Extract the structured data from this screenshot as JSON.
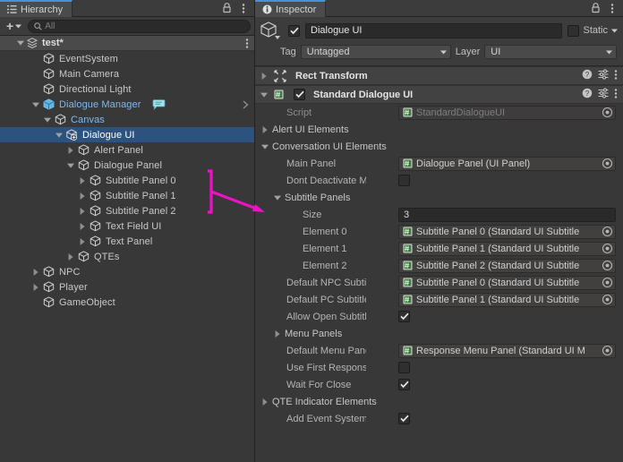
{
  "hierarchy": {
    "tab_label": "Hierarchy",
    "tab_icon": "hierarchy-icon",
    "lock_icon": "lock-icon",
    "menu_icon": "kebab-menu-icon",
    "toolbar": {
      "add_label": "+",
      "search_placeholder": "All",
      "search_value": "",
      "search_icon": "search-icon"
    },
    "scene": {
      "name": "test*",
      "icon": "scene-icon",
      "expanded": true
    },
    "items": [
      {
        "label": "EventSystem",
        "depth": 2,
        "arrow": "none",
        "icon": "cube-icon",
        "selected": false,
        "highlight": false
      },
      {
        "label": "Main Camera",
        "depth": 2,
        "arrow": "none",
        "icon": "cube-icon",
        "selected": false,
        "highlight": false
      },
      {
        "label": "Directional Light",
        "depth": 2,
        "arrow": "none",
        "icon": "cube-icon",
        "selected": false,
        "highlight": false
      },
      {
        "label": "Dialogue Manager",
        "depth": 2,
        "arrow": "expanded",
        "icon": "prefab-icon",
        "selected": false,
        "highlight": true,
        "badge": "dialogue-bubble-icon",
        "chevron": "chevron-right-icon"
      },
      {
        "label": "Canvas",
        "depth": 3,
        "arrow": "expanded",
        "icon": "cube-icon",
        "selected": false,
        "highlight": true
      },
      {
        "label": "Dialogue UI",
        "depth": 4,
        "arrow": "expanded",
        "icon": "prefab-add-icon",
        "selected": true,
        "highlight": false
      },
      {
        "label": "Alert Panel",
        "depth": 5,
        "arrow": "collapsed",
        "icon": "cube-icon",
        "selected": false,
        "highlight": false
      },
      {
        "label": "Dialogue Panel",
        "depth": 5,
        "arrow": "expanded",
        "icon": "cube-icon",
        "selected": false,
        "highlight": false
      },
      {
        "label": "Subtitle Panel 0",
        "depth": 6,
        "arrow": "collapsed",
        "icon": "cube-icon",
        "selected": false,
        "highlight": false
      },
      {
        "label": "Subtitle Panel 1",
        "depth": 6,
        "arrow": "collapsed",
        "icon": "cube-icon",
        "selected": false,
        "highlight": false
      },
      {
        "label": "Subtitle Panel 2",
        "depth": 6,
        "arrow": "collapsed",
        "icon": "cube-icon",
        "selected": false,
        "highlight": false
      },
      {
        "label": "Text Field UI",
        "depth": 6,
        "arrow": "collapsed",
        "icon": "cube-icon",
        "selected": false,
        "highlight": false
      },
      {
        "label": "Text Panel",
        "depth": 6,
        "arrow": "collapsed",
        "icon": "cube-icon",
        "selected": false,
        "highlight": false
      },
      {
        "label": "QTEs",
        "depth": 5,
        "arrow": "collapsed",
        "icon": "cube-icon",
        "selected": false,
        "highlight": false
      },
      {
        "label": "NPC",
        "depth": 2,
        "arrow": "collapsed",
        "icon": "cube-icon",
        "selected": false,
        "highlight": false
      },
      {
        "label": "Player",
        "depth": 2,
        "arrow": "collapsed",
        "icon": "cube-icon",
        "selected": false,
        "highlight": false
      },
      {
        "label": "GameObject",
        "depth": 2,
        "arrow": "none",
        "icon": "cube-icon",
        "selected": false,
        "highlight": false
      }
    ]
  },
  "inspector": {
    "tab_label": "Inspector",
    "tab_icon": "info-icon",
    "lock_icon": "lock-icon",
    "menu_icon": "kebab-menu-icon",
    "object": {
      "enabled": true,
      "name": "Dialogue UI",
      "static_label": "Static",
      "static_checked": false,
      "tag_label": "Tag",
      "tag_value": "Untagged",
      "layer_label": "Layer",
      "layer_value": "UI"
    },
    "components": [
      {
        "title": "Rect Transform",
        "icon": "rect-transform-icon",
        "expanded": false,
        "has_enable_toggle": false
      },
      {
        "title": "Standard Dialogue UI",
        "icon": "script-icon",
        "expanded": true,
        "has_enable_toggle": true,
        "enabled": true
      }
    ],
    "properties": [
      {
        "kind": "object",
        "label": "Script",
        "value": "StandardDialogueUI",
        "indent": 1,
        "disabled": true,
        "icon": "script-icon"
      },
      {
        "kind": "fold",
        "label": "Alert UI Elements",
        "expanded": false,
        "indent": 0
      },
      {
        "kind": "fold",
        "label": "Conversation UI Elements",
        "expanded": true,
        "indent": 0
      },
      {
        "kind": "object",
        "label": "Main Panel",
        "value": "Dialogue Panel (UI Panel)",
        "indent": 1,
        "disabled": false,
        "icon": "script-icon"
      },
      {
        "kind": "check",
        "label": "Dont Deactivate Main P",
        "checked": false,
        "indent": 1
      },
      {
        "kind": "fold",
        "label": "Subtitle Panels",
        "expanded": true,
        "indent": 1
      },
      {
        "kind": "number",
        "label": "Size",
        "value": "3",
        "indent": 2
      },
      {
        "kind": "object",
        "label": "Element 0",
        "value": "Subtitle Panel 0 (Standard UI Subtitle",
        "indent": 2,
        "disabled": false,
        "icon": "script-icon"
      },
      {
        "kind": "object",
        "label": "Element 1",
        "value": "Subtitle Panel 1 (Standard UI Subtitle",
        "indent": 2,
        "disabled": false,
        "icon": "script-icon"
      },
      {
        "kind": "object",
        "label": "Element 2",
        "value": "Subtitle Panel 2 (Standard UI Subtitle",
        "indent": 2,
        "disabled": false,
        "icon": "script-icon"
      },
      {
        "kind": "object",
        "label": "Default NPC Subtitle Pa",
        "value": "Subtitle Panel 0 (Standard UI Subtitle",
        "indent": 1,
        "disabled": false,
        "icon": "script-icon"
      },
      {
        "kind": "object",
        "label": "Default PC Subtitle Pan",
        "value": "Subtitle Panel 1 (Standard UI Subtitle",
        "indent": 1,
        "disabled": false,
        "icon": "script-icon"
      },
      {
        "kind": "check",
        "label": "Allow Open Subtitle Par",
        "checked": true,
        "indent": 1
      },
      {
        "kind": "fold",
        "label": "Menu Panels",
        "expanded": false,
        "indent": 1
      },
      {
        "kind": "object",
        "label": "Default Menu Panel",
        "value": "Response Menu Panel (Standard UI M",
        "indent": 1,
        "disabled": false,
        "icon": "script-icon"
      },
      {
        "kind": "check",
        "label": "Use First Response For",
        "checked": false,
        "indent": 1
      },
      {
        "kind": "check",
        "label": "Wait For Close",
        "checked": true,
        "indent": 1
      },
      {
        "kind": "fold",
        "label": "QTE Indicator Elements",
        "expanded": false,
        "indent": 0
      },
      {
        "kind": "check",
        "label": "Add Event System If Need",
        "checked": true,
        "indent": 1
      }
    ]
  },
  "annotation": {
    "color": "#ef11c6",
    "bracket_target": "subtitle-panel-rows",
    "arrow_target": "Subtitle Panels"
  },
  "colors": {
    "panel_bg": "#383838",
    "header_bg": "#3c3c3c",
    "component_bg": "#424242",
    "selection": "#2c5380",
    "tab_accent": "#4a90d9",
    "annotation": "#ef11c6",
    "text": "#c4c4c4"
  }
}
